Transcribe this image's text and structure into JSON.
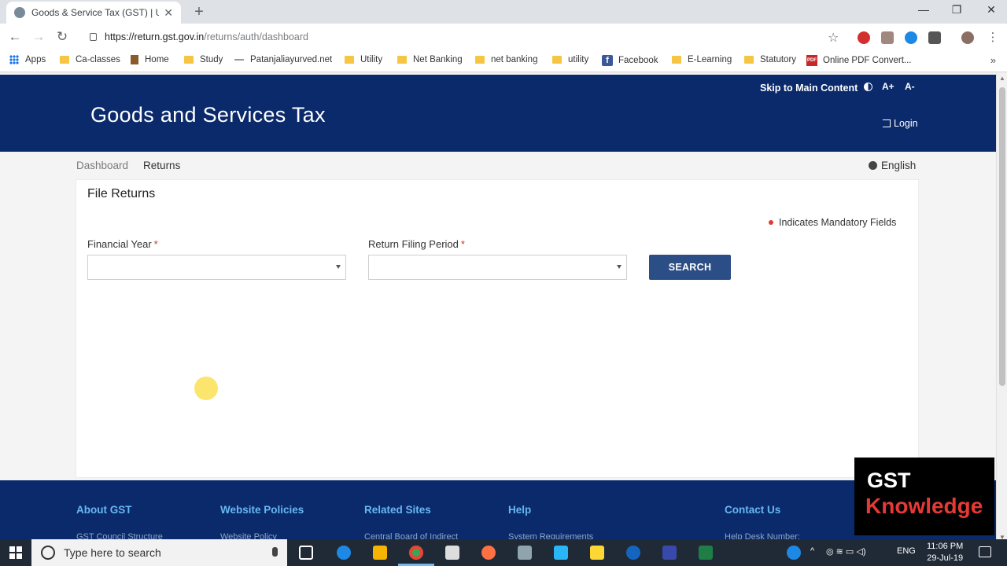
{
  "browser": {
    "tab_title": "Goods & Service Tax (GST) | User",
    "url_host": "https://return.gst.gov.in",
    "url_path": "/returns/auth/dashboard"
  },
  "bookmarks": [
    "Apps",
    "Ca-classes",
    "Home",
    "Study",
    "Patanjaliayurved.net",
    "Utility",
    "Net Banking",
    "net banking",
    "utility",
    "Facebook",
    "E-Learning",
    "Statutory",
    "Online PDF Convert..."
  ],
  "header": {
    "skip": "Skip to Main Content",
    "aplus": "A+",
    "aminus": "A-",
    "title": "Goods and Services Tax",
    "login": "Login"
  },
  "breadcrumb": {
    "dashboard": "Dashboard",
    "returns": "Returns"
  },
  "language": "English",
  "form": {
    "title": "File Returns",
    "mandatory_note": "Indicates Mandatory Fields",
    "financial_year_label": "Financial Year",
    "financial_year_value": "",
    "period_label": "Return Filing Period",
    "period_value": "",
    "required_mark": "*",
    "search_label": "SEARCH"
  },
  "footer": {
    "headings": [
      "About GST",
      "Website Policies",
      "Related Sites",
      "Help",
      "Contact Us"
    ],
    "sublinks": [
      "GST Council Structure",
      "Website Policy",
      "Central Board of Indirect",
      "System Requirements",
      "Help Desk Number:"
    ]
  },
  "watermark": {
    "line1": "GST",
    "line2": "Knowledge"
  },
  "taskbar": {
    "search_placeholder": "Type here to search",
    "lang": "ENG",
    "time": "11:06 PM",
    "date": "29-Jul-19"
  },
  "colors": {
    "header_bg": "#0b2a6b",
    "button_bg": "#2c4e86",
    "footer_heading": "#67b7f3"
  }
}
